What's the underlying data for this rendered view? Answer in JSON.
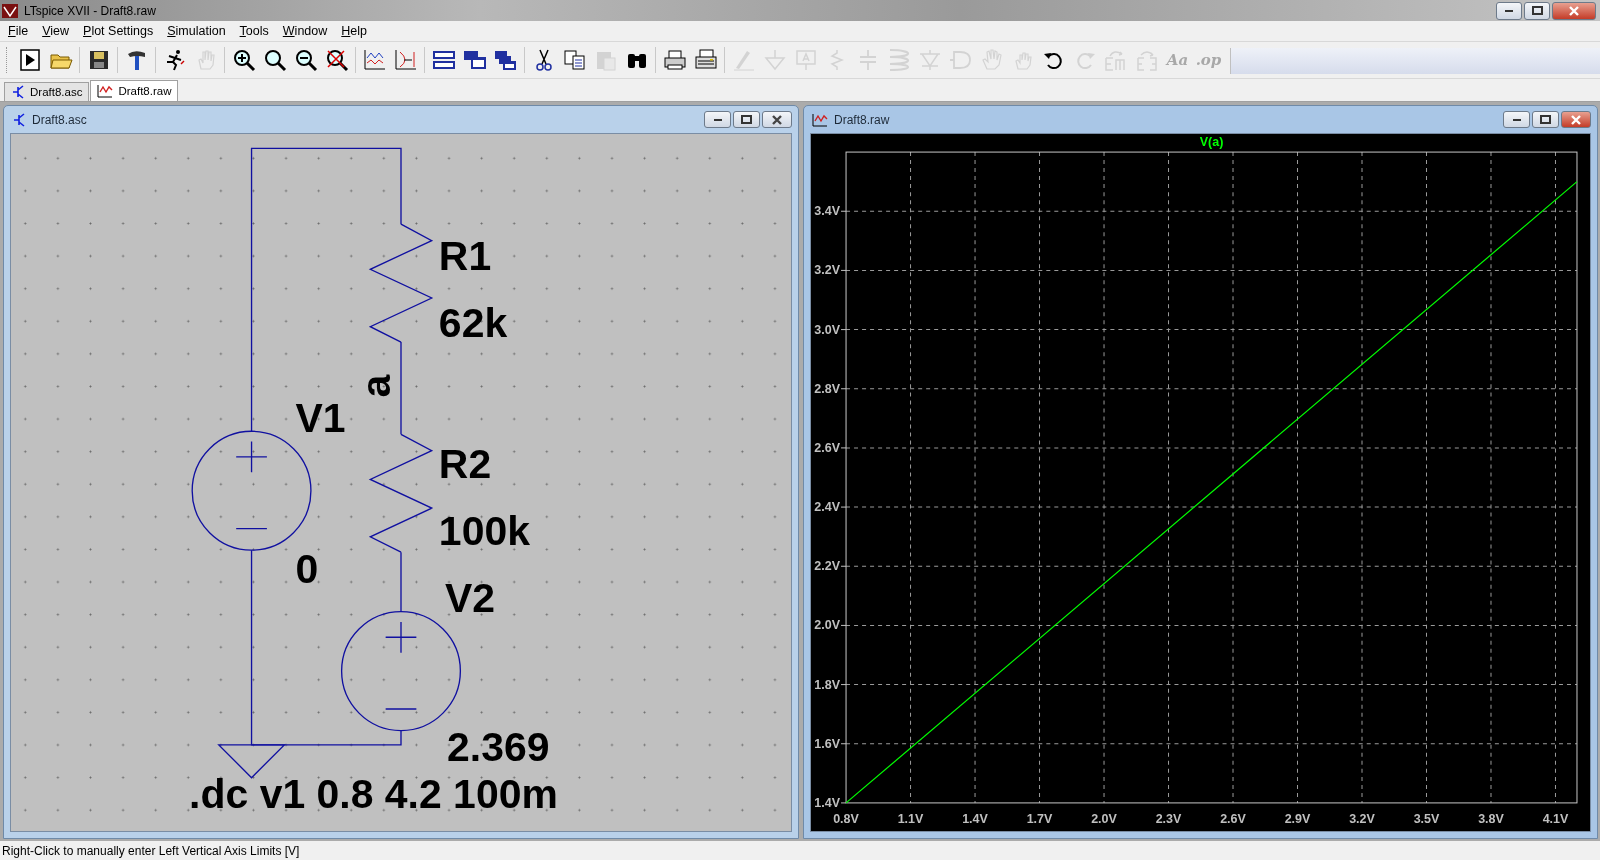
{
  "window": {
    "title": "LTspice XVII - Draft8.raw"
  },
  "menu": [
    {
      "label": "File"
    },
    {
      "label": "View"
    },
    {
      "label": "Plot Settings"
    },
    {
      "label": "Simulation"
    },
    {
      "label": "Tools"
    },
    {
      "label": "Window"
    },
    {
      "label": "Help"
    }
  ],
  "toolbar": [
    {
      "disabled": false
    },
    {
      "disabled": false
    },
    {
      "disabled": false
    },
    {
      "disabled": false
    },
    {
      "disabled": false
    },
    {
      "disabled": true
    },
    {
      "disabled": false
    },
    {
      "disabled": false
    },
    {
      "disabled": false
    },
    {
      "disabled": false
    },
    {
      "disabled": false
    },
    {
      "disabled": false
    },
    {
      "disabled": false
    },
    {
      "disabled": false
    },
    {
      "disabled": false
    },
    {
      "disabled": false
    },
    {
      "disabled": false
    },
    {
      "disabled": true
    },
    {
      "disabled": false
    },
    {
      "disabled": false
    },
    {
      "disabled": false
    },
    {
      "disabled": true
    },
    {
      "disabled": true
    },
    {
      "disabled": true
    },
    {
      "disabled": true
    },
    {
      "disabled": true
    },
    {
      "disabled": true
    },
    {
      "disabled": true
    },
    {
      "disabled": true
    },
    {
      "disabled": true
    },
    {
      "disabled": true
    },
    {
      "disabled": false
    },
    {
      "disabled": true
    },
    {
      "disabled": true
    },
    {
      "disabled": true
    },
    {
      "disabled": true,
      "glyph": "Aa"
    },
    {
      "disabled": true,
      "glyph": ".op"
    }
  ],
  "tabs": [
    {
      "label": "Draft8.asc",
      "kind": "schematic",
      "selected": false
    },
    {
      "label": "Draft8.raw",
      "kind": "waveform",
      "selected": true
    }
  ],
  "schematic_window": {
    "title": "Draft8.asc",
    "active": false,
    "labels": [
      {
        "text": "R1"
      },
      {
        "text": "62k"
      },
      {
        "text": "a"
      },
      {
        "text": "V1"
      },
      {
        "text": "R2"
      },
      {
        "text": "100k"
      },
      {
        "text": "0"
      },
      {
        "text": "V2"
      },
      {
        "text": "2.369"
      },
      {
        "text": ".dc v1 0.8 4.2 100m"
      }
    ]
  },
  "plot_window": {
    "title": "Draft8.raw",
    "active": true,
    "chart_data": {
      "type": "line",
      "grid": true,
      "x": [
        0.8,
        4.2
      ],
      "series": [
        {
          "name": "V(a)",
          "color": "#00ff00",
          "values": [
            1.4,
            3.5
          ]
        }
      ],
      "xlim": [
        0.8,
        4.2
      ],
      "ylim": [
        1.4,
        3.6
      ],
      "xticks": [
        {
          "value": 0.8,
          "label": "0.8V"
        },
        {
          "value": 1.1,
          "label": "1.1V"
        },
        {
          "value": 1.4,
          "label": "1.4V"
        },
        {
          "value": 1.7,
          "label": "1.7V"
        },
        {
          "value": 2.0,
          "label": "2.0V"
        },
        {
          "value": 2.3,
          "label": "2.3V"
        },
        {
          "value": 2.6,
          "label": "2.6V"
        },
        {
          "value": 2.9,
          "label": "2.9V"
        },
        {
          "value": 3.2,
          "label": "3.2V"
        },
        {
          "value": 3.5,
          "label": "3.5V"
        },
        {
          "value": 3.8,
          "label": "3.8V"
        },
        {
          "value": 4.1,
          "label": "4.1V"
        }
      ],
      "yticks": [
        {
          "value": 1.4,
          "label": "1.4V"
        },
        {
          "value": 1.6,
          "label": "1.6V"
        },
        {
          "value": 1.8,
          "label": "1.8V"
        },
        {
          "value": 2.0,
          "label": "2.0V"
        },
        {
          "value": 2.2,
          "label": "2.2V"
        },
        {
          "value": 2.4,
          "label": "2.4V"
        },
        {
          "value": 2.6,
          "label": "2.6V"
        },
        {
          "value": 2.8,
          "label": "2.8V"
        },
        {
          "value": 3.0,
          "label": "3.0V"
        },
        {
          "value": 3.2,
          "label": "3.2V"
        },
        {
          "value": 3.4,
          "label": "3.4V"
        }
      ]
    }
  },
  "status_bar": {
    "text": "Right-Click to manually enter Left Vertical Axis Limits [V]"
  }
}
